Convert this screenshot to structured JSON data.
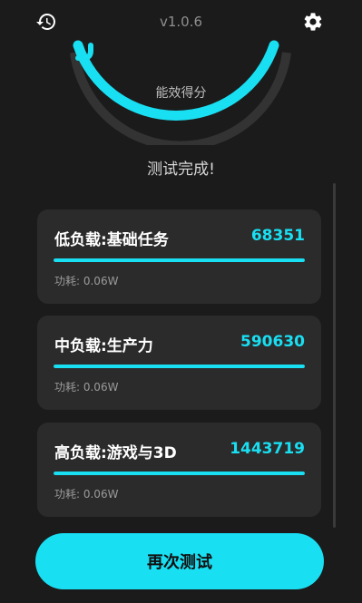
{
  "header": {
    "version": "v1.0.6",
    "history_icon": "history-icon",
    "settings_icon": "gear-icon"
  },
  "gauge": {
    "label": "能效得分"
  },
  "status": "测试完成!",
  "results": [
    {
      "title": "低负载:基础任务",
      "score": "68351",
      "power": "功耗: 0.06W",
      "progress": 1.0
    },
    {
      "title": "中负载:生产力",
      "score": "590630",
      "power": "功耗: 0.06W",
      "progress": 1.0
    },
    {
      "title": "高负载:游戏与3D",
      "score": "1443719",
      "power": "功耗: 0.06W",
      "progress": 1.0
    }
  ],
  "retest_label": "再次测试",
  "colors": {
    "accent": "#19dff2",
    "background": "#1b1b1b",
    "card": "#2b2b2b"
  }
}
